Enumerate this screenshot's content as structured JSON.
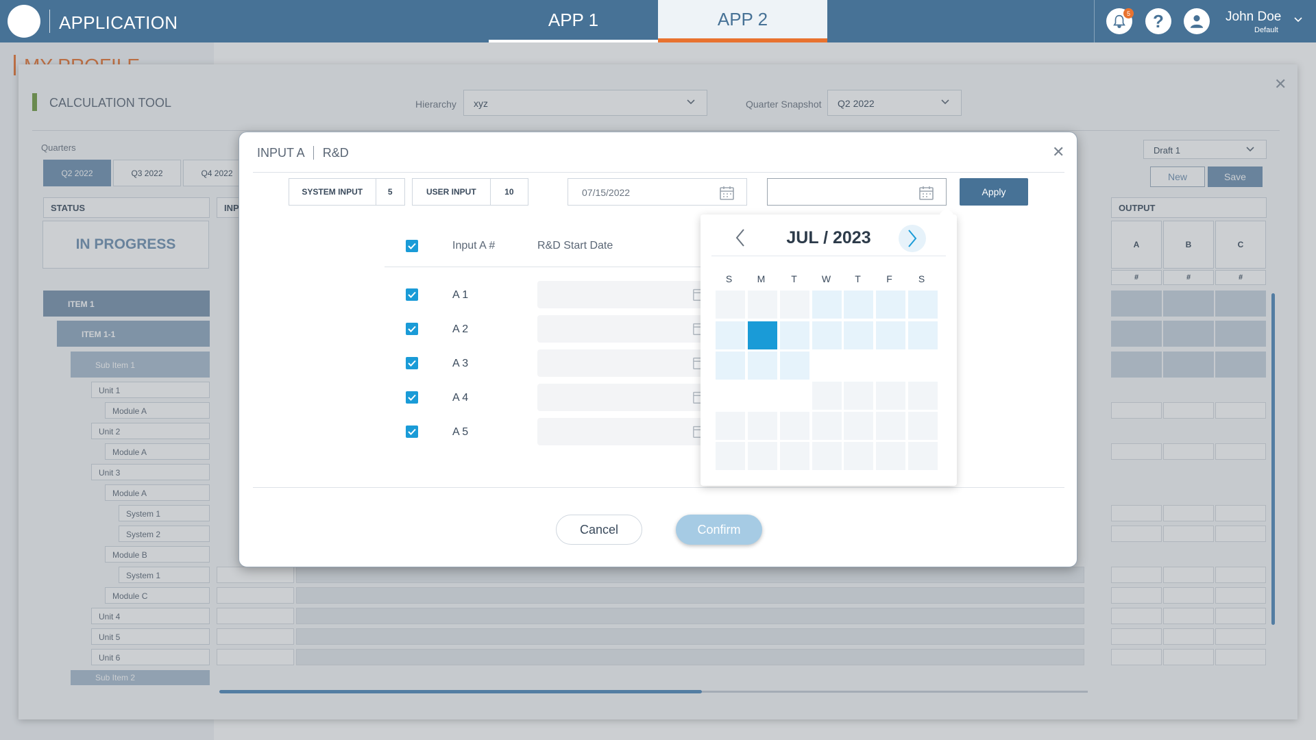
{
  "topbar": {
    "app_name": "APPLICATION",
    "tabs": [
      {
        "label": "APP 1"
      },
      {
        "label": "APP 2"
      }
    ],
    "notification_count": "5",
    "user_name": "John Doe",
    "user_role": "Default"
  },
  "page": {
    "title": "MY PROFILE"
  },
  "tool": {
    "title": "CALCULATION TOOL",
    "hierarchy_label": "Hierarchy",
    "hierarchy_value": "xyz",
    "quarter_label": "Quarter Snapshot",
    "quarter_value": "Q2 2022",
    "quarters_label": "Quarters",
    "quarter_tabs": [
      "Q2 2022",
      "Q3 2022",
      "Q4 2022"
    ],
    "draft_value": "Draft 1",
    "new_label": "New",
    "save_label": "Save",
    "status_header": "STATUS",
    "status_value": "IN PROGRESS",
    "input_header": "INP",
    "output_header": "OUTPUT",
    "output_cols": [
      "A",
      "B",
      "C"
    ],
    "output_hash": "#",
    "tree": {
      "item1": "ITEM 1",
      "item11": "ITEM 1-1",
      "sub1": "Sub Item 1",
      "unit1": "Unit 1",
      "unit2": "Unit 2",
      "unit3": "Unit 3",
      "unit4": "Unit 4",
      "unit5": "Unit 5",
      "unit6": "Unit 6",
      "module_a": "Module A",
      "module_b": "Module B",
      "module_c": "Module C",
      "system1": "System 1",
      "system2": "System 2",
      "sub2": "Sub Item 2"
    }
  },
  "modal": {
    "title": "INPUT A",
    "subtitle": "R&D",
    "system_input_label": "SYSTEM INPUT",
    "system_input_value": "5",
    "user_input_label": "USER INPUT",
    "user_input_value": "10",
    "date_from": "07/15/2022",
    "date_to": "",
    "apply_label": "Apply",
    "col_input": "Input A #",
    "col_start": "R&D Start Date",
    "rows": [
      "A 1",
      "A 2",
      "A 3",
      "A 4",
      "A 5"
    ],
    "cancel_label": "Cancel",
    "confirm_label": "Confirm"
  },
  "calendar": {
    "month_label": "JUL / 2023",
    "weekdays": [
      "S",
      "M",
      "T",
      "W",
      "T",
      "F",
      "S"
    ]
  },
  "colors": {
    "header_bg": "#477296",
    "accent_orange": "#e8722f",
    "checkbox_blue": "#1a9bd7",
    "apply_blue": "#477296"
  }
}
